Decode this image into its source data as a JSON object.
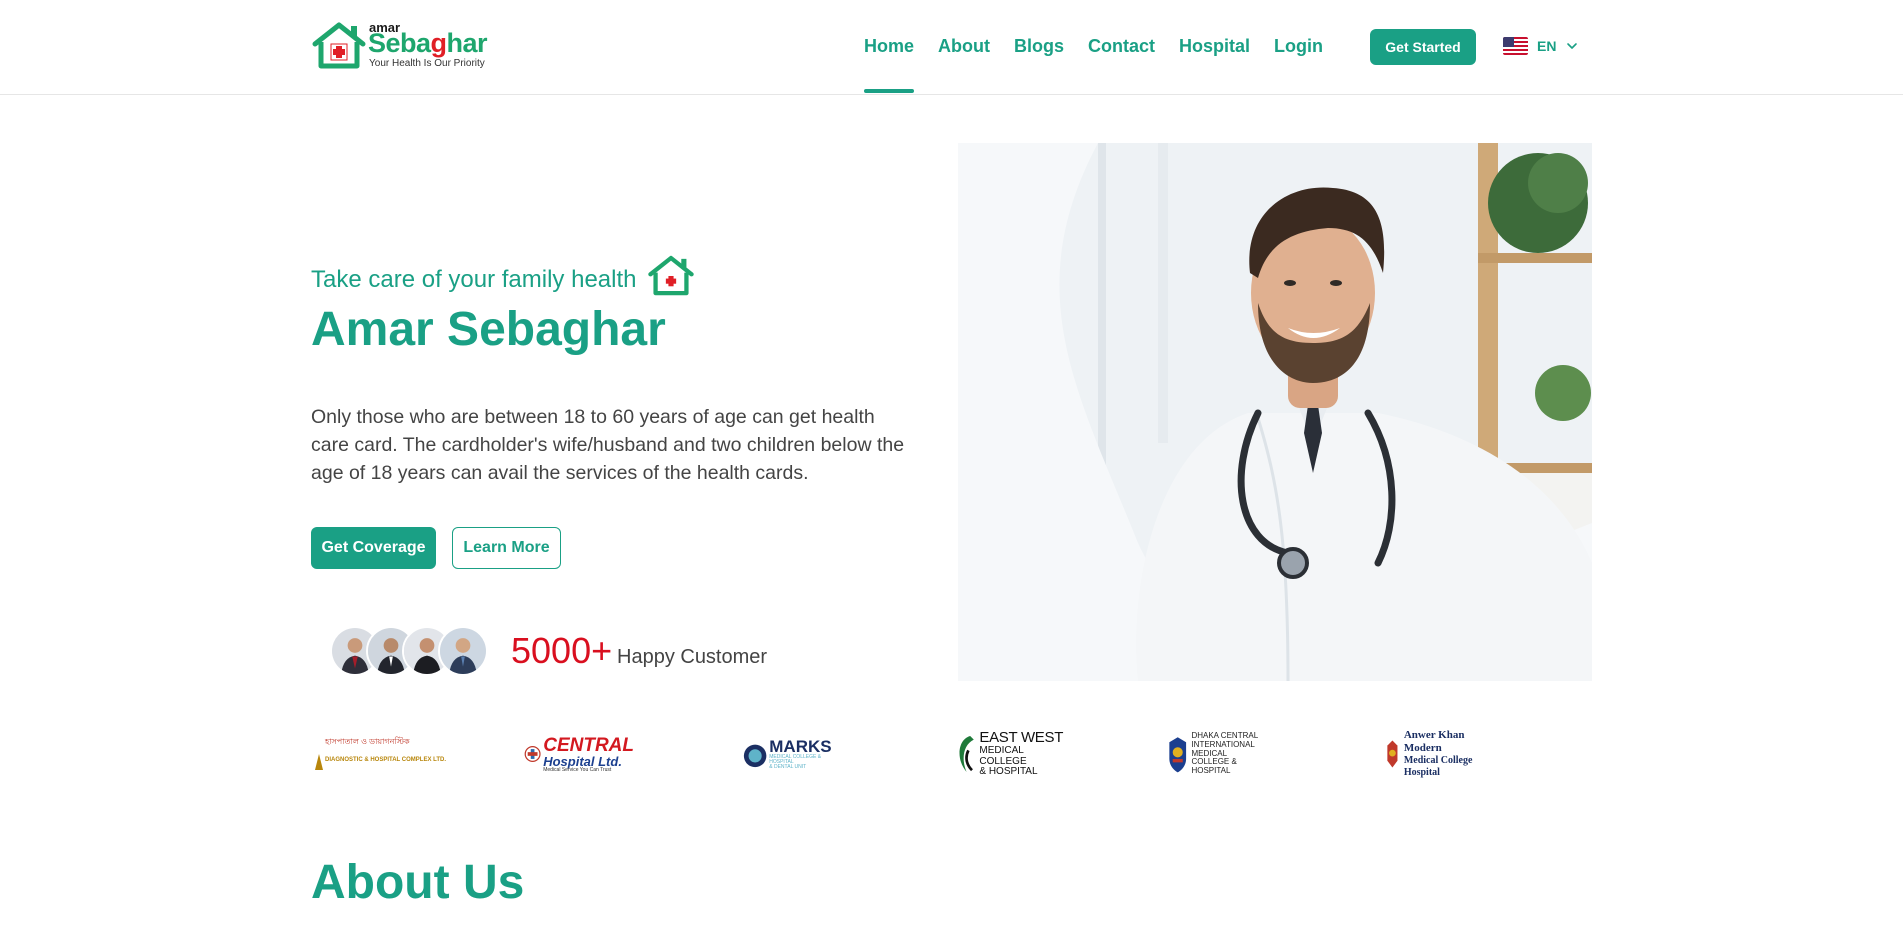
{
  "header": {
    "logo": {
      "small": "amar",
      "brand_part1": "Seba",
      "brand_part2": "g",
      "brand_part3": "har",
      "tagline": "Your Health Is Our Priority"
    },
    "nav": [
      {
        "label": "Home",
        "active": true
      },
      {
        "label": "About",
        "active": false
      },
      {
        "label": "Blogs",
        "active": false
      },
      {
        "label": "Contact",
        "active": false
      },
      {
        "label": "Hospital",
        "active": false
      },
      {
        "label": "Login",
        "active": false
      }
    ],
    "cta_label": "Get Started",
    "language": {
      "code": "EN",
      "flag": "us-flag-icon"
    }
  },
  "hero": {
    "eyebrow": "Take care of your family health",
    "title": "Amar Sebaghar",
    "description": "Only those who are between 18 to 60 years of age can get health care card. The cardholder's wife/husband and two children below the age of 18 years can avail the services of the health cards.",
    "primary_button": "Get Coverage",
    "secondary_button": "Learn More",
    "customer_count": "5000+",
    "customer_label": "Happy Customer"
  },
  "partners": [
    {
      "name": "Diagnostic & Hospital Complex",
      "line1": "হাসপাতাল ও ডায়াগনস্টিক",
      "line2": "DIAGNOSTIC & HOSPITAL COMPLEX LTD."
    },
    {
      "name": "Central Hospital Ltd.",
      "line1": "CENTRAL",
      "line2": "Hospital Ltd.",
      "line3": "Medical Service You Can Trust"
    },
    {
      "name": "Marks",
      "line1": "MARKS",
      "line2": "MEDICAL COLLEGE & HOSPITAL",
      "line3": "& DENTAL UNIT"
    },
    {
      "name": "East West",
      "line1": "EAST WEST",
      "line2": "MEDICAL COLLEGE",
      "line3": "& HOSPITAL"
    },
    {
      "name": "Dhaka Central",
      "line1": "DHAKA CENTRAL",
      "line2": "INTERNATIONAL MEDICAL",
      "line3": "COLLEGE & HOSPITAL"
    },
    {
      "name": "Anwer Khan Modern",
      "line1": "Anwer Khan Modern",
      "line2": "Medical College Hospital"
    }
  ],
  "about": {
    "title": "About Us"
  },
  "colors": {
    "primary": "#1aa085",
    "accent_red": "#d90f1f",
    "logo_green": "#1ea66d"
  }
}
